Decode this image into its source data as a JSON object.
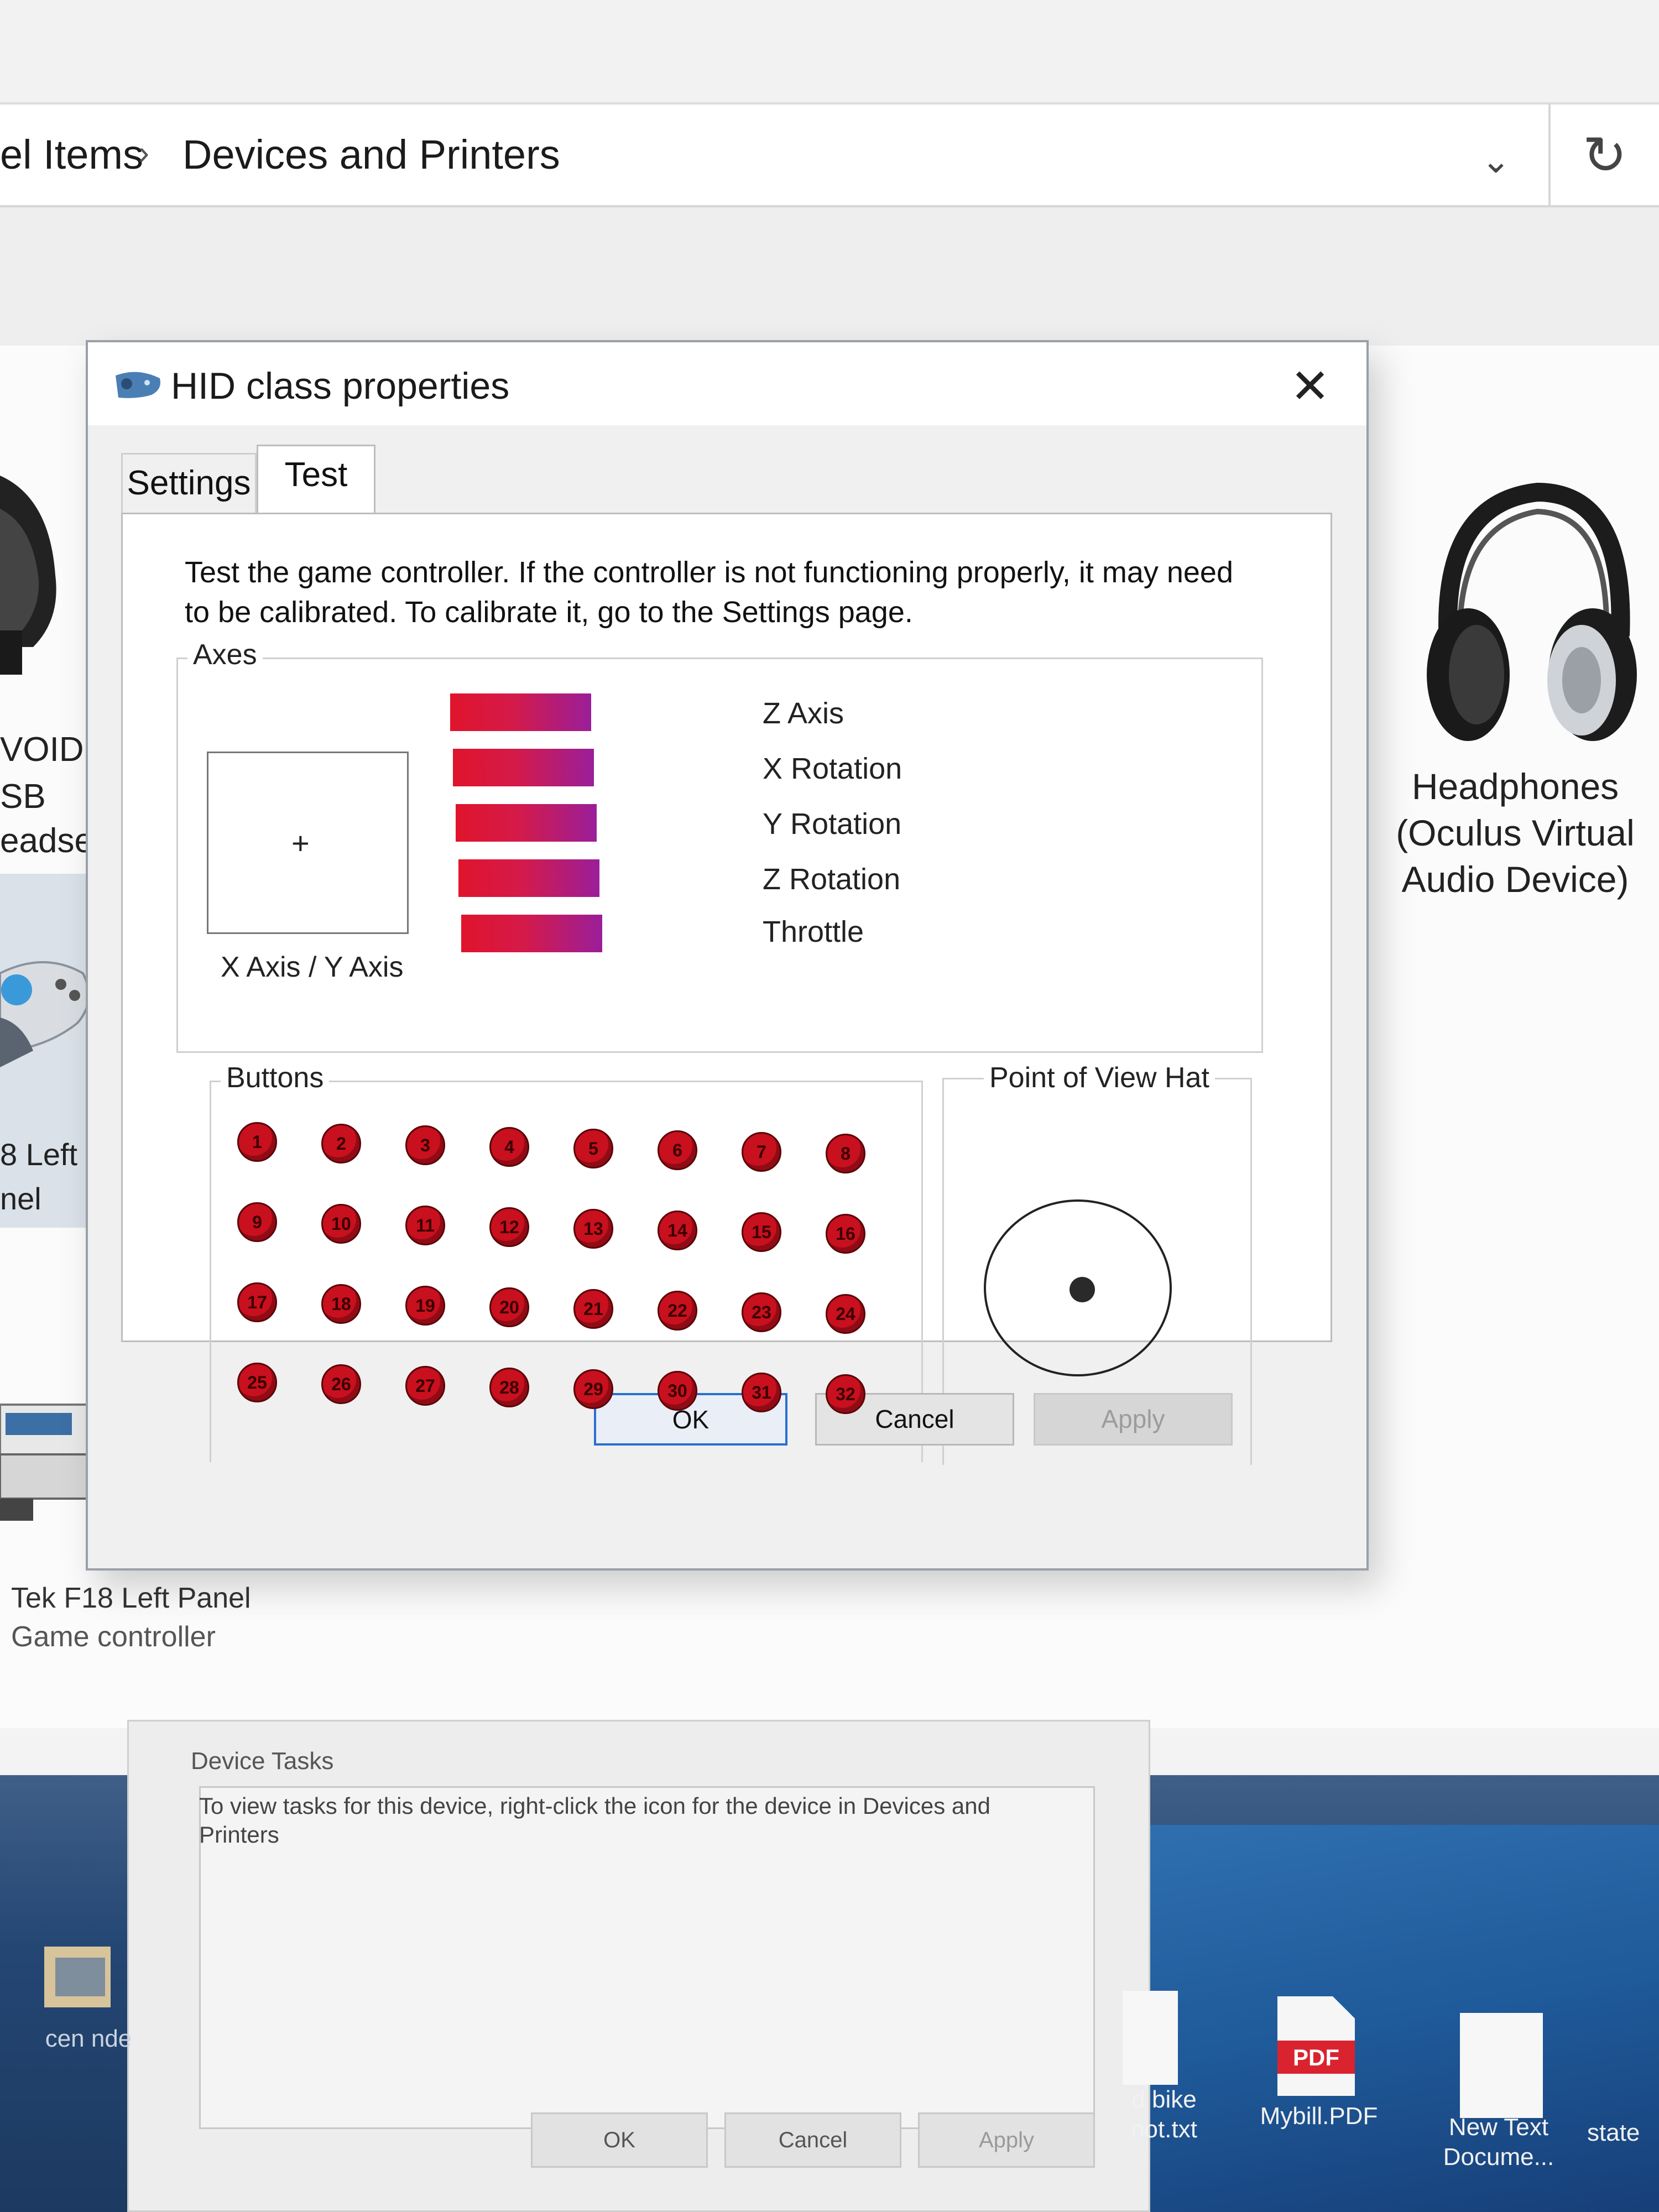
{
  "explorer": {
    "breadcrumb": [
      "el Items",
      "Devices and Printers"
    ],
    "breadcrumb_separator": "›",
    "dropdown_glyph": "⌄",
    "refresh_glyph": "↻"
  },
  "devices": {
    "left_headset_lines": [
      "VOID",
      "SB",
      "eadset"
    ],
    "left_panel_lines": [
      "8 Left",
      "nel"
    ],
    "tek_name": "Tek F18 Left Panel",
    "tek_type": "Game controller",
    "headphones_lines": [
      "Headphones",
      "(Oculus Virtual",
      "Audio Device)"
    ]
  },
  "background_panel": {
    "device_tasks_title": "Device Tasks",
    "device_tasks_text": "To view tasks for this device, right-click the icon for the device in Devices and Printers",
    "ok": "OK",
    "cancel": "Cancel",
    "apply": "Apply"
  },
  "desktop": {
    "icons": [
      {
        "label": "cen nde"
      },
      {
        "label": "d bike\nnot.txt"
      },
      {
        "label": "Mybill.PDF",
        "badge": "PDF"
      },
      {
        "label": "New Text\nDocume..."
      },
      {
        "label": "state"
      }
    ]
  },
  "dialog": {
    "title": "HID class properties",
    "close_glyph": "✕",
    "tabs": [
      "Settings",
      "Test"
    ],
    "active_tab": "Test",
    "description": "Test the game controller.  If the controller is not functioning properly, it may need to be calibrated.  To calibrate it, go to the Settings page.",
    "axes_group_label": "Axes",
    "xy_cross": "+",
    "xy_label": "X Axis / Y Axis",
    "axis_labels": [
      "Z Axis",
      "X Rotation",
      "Y Rotation",
      "Z Rotation",
      "Throttle"
    ],
    "buttons_group_label": "Buttons",
    "buttons": [
      "1",
      "2",
      "3",
      "4",
      "5",
      "6",
      "7",
      "8",
      "9",
      "10",
      "11",
      "12",
      "13",
      "14",
      "15",
      "16",
      "17",
      "18",
      "19",
      "20",
      "21",
      "22",
      "23",
      "24",
      "25",
      "26",
      "27",
      "28",
      "29",
      "30",
      "31",
      "32"
    ],
    "pov_group_label": "Point of View Hat",
    "ok": "OK",
    "cancel": "Cancel",
    "apply": "Apply"
  },
  "colors": {
    "axis_bar_start": "#e0142c",
    "axis_bar_end": "#9a1e9a",
    "button_red": "#c8101e",
    "ok_focus_border": "#2a6fd0"
  }
}
